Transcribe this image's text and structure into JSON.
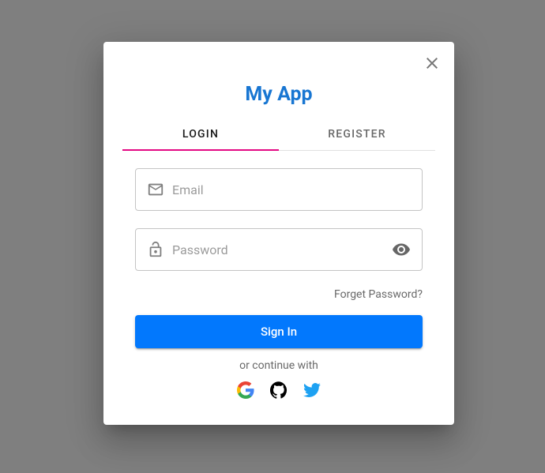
{
  "app": {
    "title": "My App"
  },
  "tabs": {
    "login": "LOGIN",
    "register": "REGISTER"
  },
  "form": {
    "email": {
      "placeholder": "Email",
      "value": ""
    },
    "password": {
      "placeholder": "Password",
      "value": ""
    },
    "forgot": "Forget Password?",
    "submit": "Sign In",
    "continueWith": "or continue with"
  },
  "colors": {
    "primary": "#1876d2",
    "accent": "#e30883",
    "button": "#0278fd"
  }
}
